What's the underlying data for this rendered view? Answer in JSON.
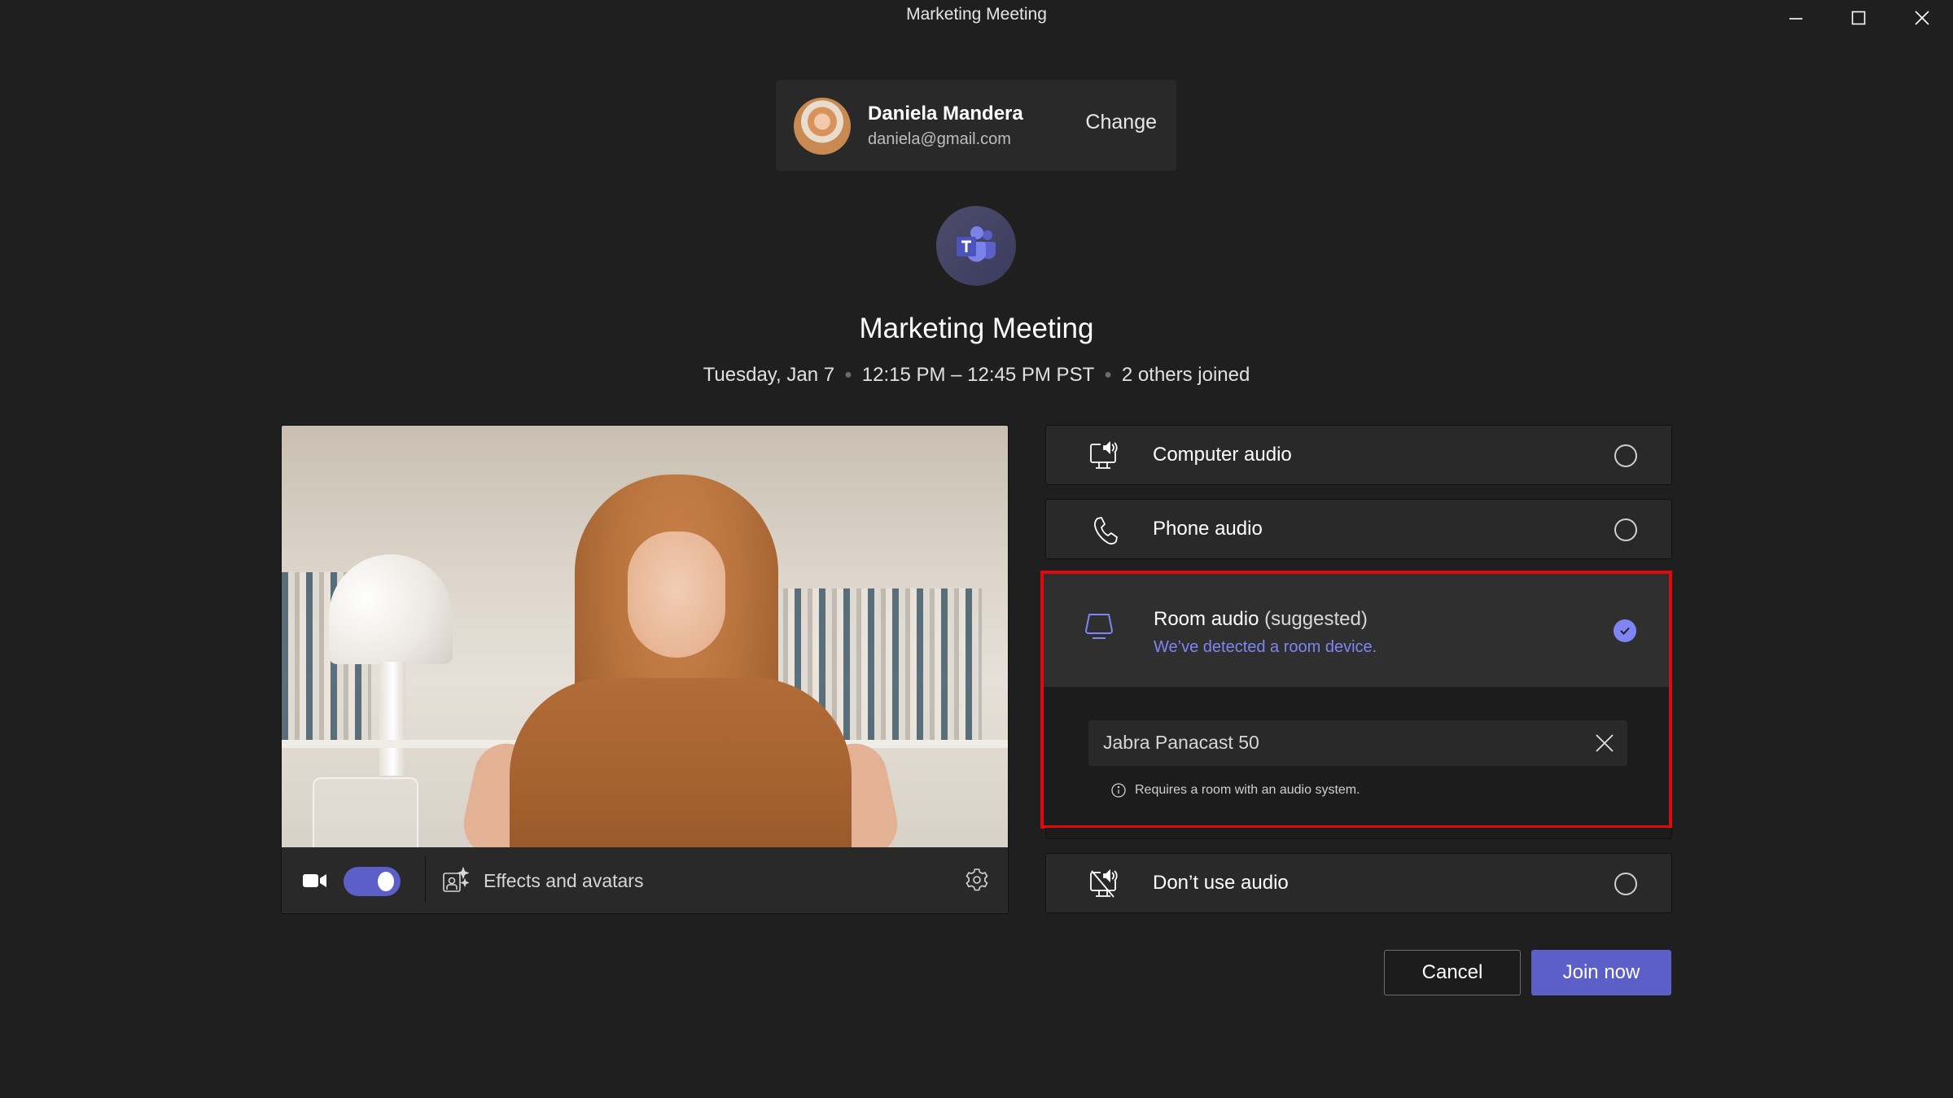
{
  "window": {
    "title": "Marketing Meeting",
    "controls": [
      "minimize",
      "maximize",
      "close"
    ]
  },
  "account": {
    "name": "Daniela Mandera",
    "email": "daniela@gmail.com",
    "change_label": "Change"
  },
  "meeting": {
    "app_icon": "teams-logo-icon",
    "title": "Marketing Meeting",
    "date": "Tuesday, Jan 7",
    "time": "12:15 PM – 12:45 PM PST",
    "participants": "2 others joined"
  },
  "video": {
    "camera_on": true,
    "effects_label": "Effects and avatars"
  },
  "audio_options": {
    "computer": {
      "label": "Computer audio",
      "icon": "computer-speaker-icon",
      "selected": false
    },
    "phone": {
      "label": "Phone audio",
      "icon": "phone-icon",
      "selected": false
    },
    "room": {
      "label": "Room audio",
      "suffix": "(suggested)",
      "subtitle": "We’ve detected a room device.",
      "icon": "room-device-icon",
      "selected": true,
      "device_value": "Jabra Panacast 50",
      "hint": "Requires a room with an audio system."
    },
    "none": {
      "label": "Don’t use audio",
      "icon": "speaker-off-icon",
      "selected": false
    }
  },
  "actions": {
    "cancel_label": "Cancel",
    "join_label": "Join now"
  },
  "colors": {
    "accent": "#5b5fc7",
    "accent_light": "#7f85f5",
    "highlight_border": "#e0090b",
    "background": "#1f1f1f"
  }
}
